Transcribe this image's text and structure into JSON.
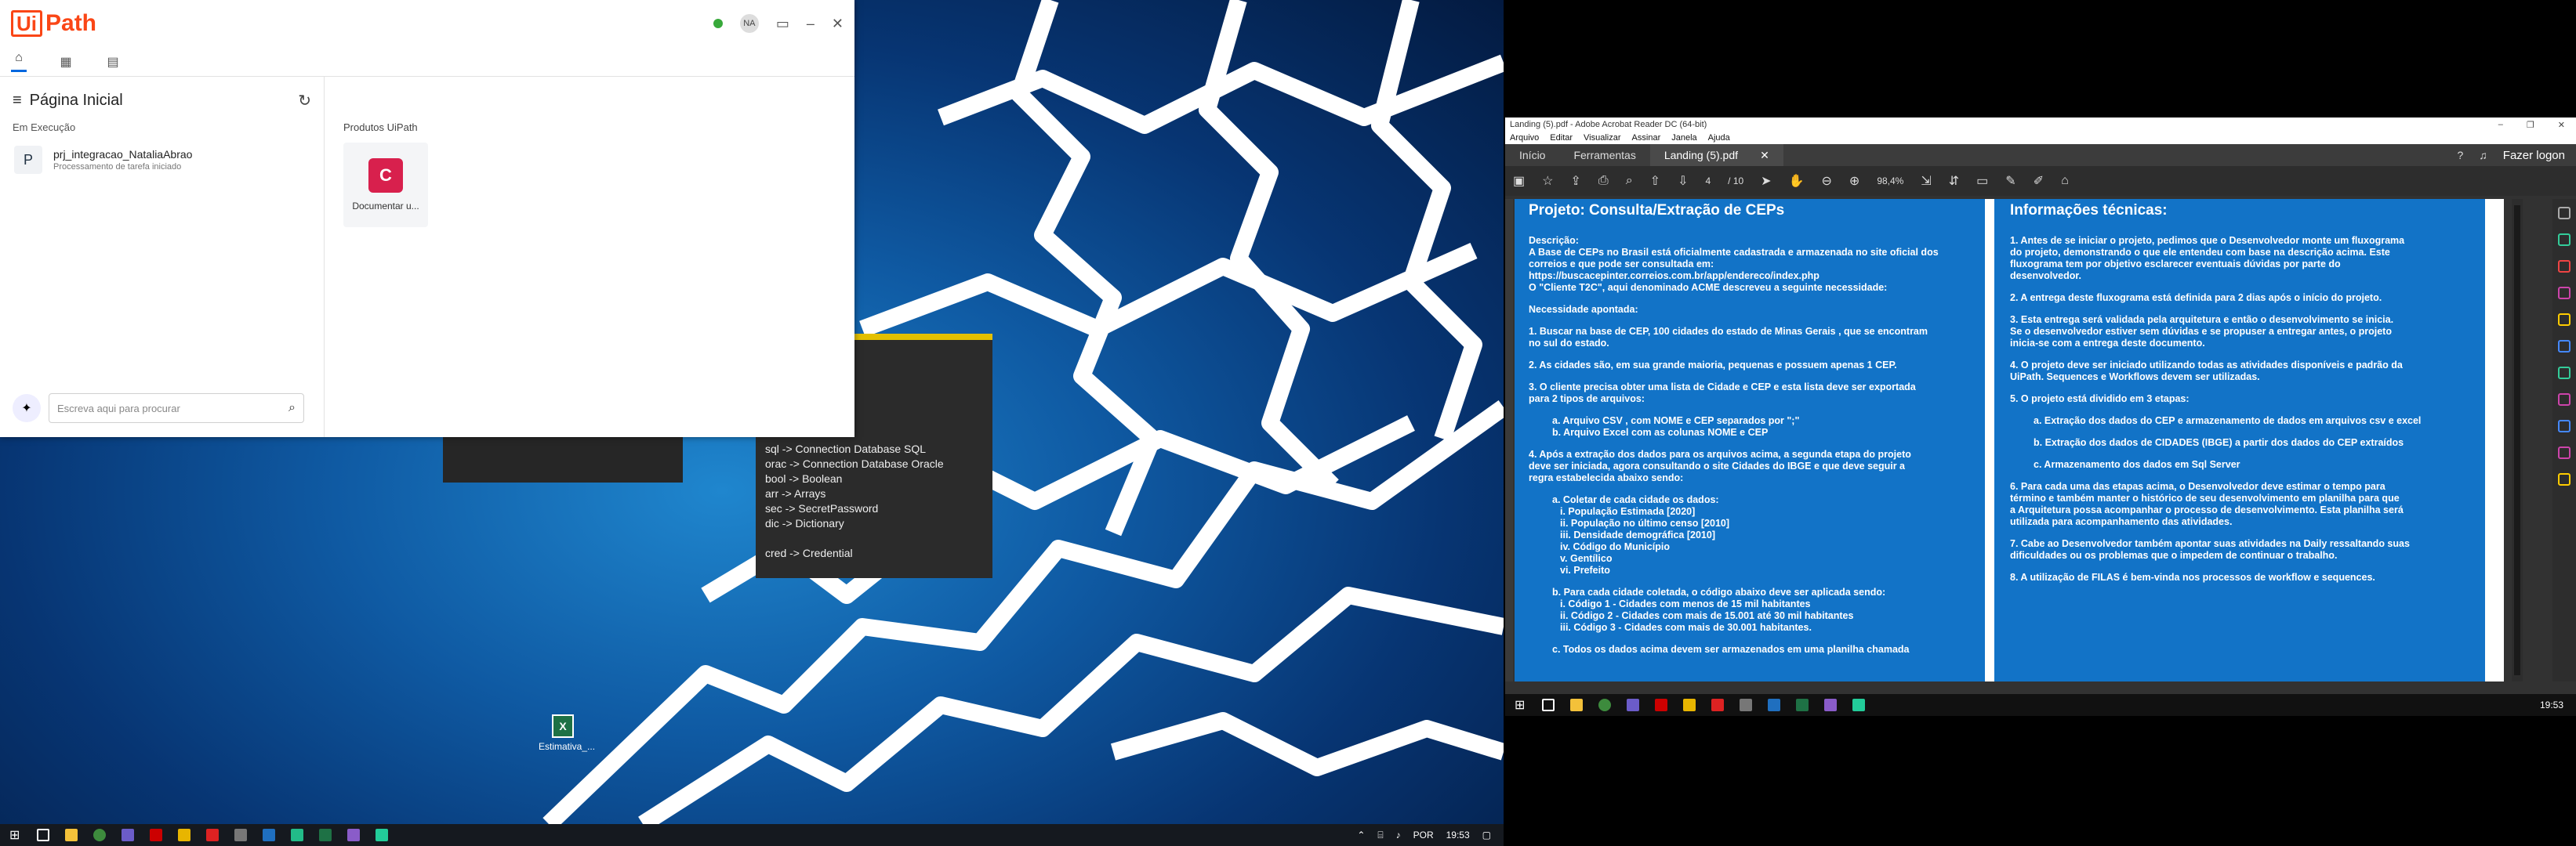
{
  "colors": {
    "uipath_orange": "#fa4616",
    "acrobat_blue": "#1273c7",
    "popup_accent": "#e3c000"
  },
  "uipath": {
    "logo_box": "Ui",
    "logo_text": "Path",
    "window_controls": [
      "minimize",
      "close"
    ],
    "avatar": "NA",
    "page_title": "Página Inicial",
    "section_running": "Em Execução",
    "process": {
      "icon": "P",
      "name": "prj_integracao_NataliaAbrao",
      "status": "Processamento de tarefa iniciado"
    },
    "products_title": "Produtos UiPath",
    "product_card_label": "Documentar u...",
    "search_placeholder": "Escreva aqui para procurar"
  },
  "popup": {
    "items": [
      "sql -> Connection Database SQL",
      "orac -> Connection Database Oracle",
      "bool -> Boolean",
      "arr -> Arrays",
      "sec -> SecretPassword",
      "dic -> Dictionary",
      "",
      "cred -> Credential"
    ]
  },
  "desktop_icon": {
    "label": "Estimativa_..."
  },
  "taskbar_left": {
    "lang": "POR",
    "time": "19:53"
  },
  "taskbar_right": {
    "time": "19:53"
  },
  "acrobat": {
    "title": "Landing (5).pdf - Adobe Acrobat Reader DC (64-bit)",
    "menu": [
      "Arquivo",
      "Editar",
      "Visualizar",
      "Assinar",
      "Janela",
      "Ajuda"
    ],
    "tabs": {
      "home": "Início",
      "tools": "Ferramentas",
      "doc": "Landing (5).pdf",
      "login": "Fazer logon"
    },
    "page_current": "4",
    "page_total": "/ 10",
    "zoom": "98,4%",
    "col1": {
      "title": "Projeto: Consulta/Extração de CEPs",
      "lines": [
        {
          "t": "Descrição:",
          "c": ""
        },
        {
          "t": "A Base de CEPs no Brasil está oficialmente cadastrada e armazenada no site oficial dos",
          "c": ""
        },
        {
          "t": "correios e que pode ser consultada em:",
          "c": ""
        },
        {
          "t": "https://buscacepinter.correios.com.br/app/endereco/index.php",
          "c": ""
        },
        {
          "t": "O \"Cliente T2C\", aqui denominado ACME descreveu a seguinte necessidade:",
          "c": ""
        },
        {
          "t": "",
          "c": "sp"
        },
        {
          "t": "Necessidade apontada:",
          "c": ""
        },
        {
          "t": "",
          "c": "sp"
        },
        {
          "t": "1. Buscar na base de CEP, 100 cidades do estado de Minas Gerais , que se encontram",
          "c": ""
        },
        {
          "t": "no sul do estado.",
          "c": ""
        },
        {
          "t": "",
          "c": "sp"
        },
        {
          "t": "2. As cidades são, em sua grande maioria, pequenas e possuem apenas 1 CEP.",
          "c": ""
        },
        {
          "t": "",
          "c": "sp"
        },
        {
          "t": "3. O cliente precisa obter uma lista de Cidade e CEP e esta lista deve ser exportada",
          "c": ""
        },
        {
          "t": "para 2 tipos de arquivos:",
          "c": ""
        },
        {
          "t": "",
          "c": "sp"
        },
        {
          "t": "a. Arquivo CSV , com NOME e CEP separados por \";\"",
          "c": "ind"
        },
        {
          "t": "b. Arquivo Excel com as colunas NOME e CEP",
          "c": "ind"
        },
        {
          "t": "",
          "c": "sp"
        },
        {
          "t": "4. Após a extração dos dados para os arquivos acima, a segunda etapa do projeto",
          "c": ""
        },
        {
          "t": "deve ser iniciada, agora consultando o site Cidades do IBGE e que deve seguir a",
          "c": ""
        },
        {
          "t": "regra estabelecida abaixo sendo:",
          "c": ""
        },
        {
          "t": "",
          "c": "sp"
        },
        {
          "t": "a. Coletar de cada cidade os dados:",
          "c": "ind"
        },
        {
          "t": "i. População Estimada [2020]",
          "c": "ind2"
        },
        {
          "t": "ii. População no último censo [2010]",
          "c": "ind2"
        },
        {
          "t": "iii. Densidade demográfica [2010]",
          "c": "ind2"
        },
        {
          "t": "iv. Código do Município",
          "c": "ind2"
        },
        {
          "t": "v. Gentílico",
          "c": "ind2"
        },
        {
          "t": "vi. Prefeito",
          "c": "ind2"
        },
        {
          "t": "",
          "c": "sp"
        },
        {
          "t": "b. Para cada cidade coletada, o código abaixo deve ser aplicada sendo:",
          "c": "ind"
        },
        {
          "t": "i. Código 1 - Cidades com menos de 15 mil habitantes",
          "c": "ind2"
        },
        {
          "t": "ii. Código 2 - Cidades com mais de 15.001 até 30 mil habitantes",
          "c": "ind2"
        },
        {
          "t": "iii. Código 3 - Cidades com mais de 30.001 habitantes.",
          "c": "ind2"
        },
        {
          "t": "",
          "c": "sp"
        },
        {
          "t": "c. Todos os dados acima devem ser armazenados em uma planilha chamada",
          "c": "ind"
        }
      ]
    },
    "col2": {
      "title": "Informações técnicas:",
      "lines": [
        {
          "t": "1. Antes de se iniciar o projeto, pedimos que o Desenvolvedor monte um fluxograma",
          "c": ""
        },
        {
          "t": "do projeto, demonstrando o que ele entendeu com base na descrição acima. Este",
          "c": ""
        },
        {
          "t": "fluxograma tem por objetivo esclarecer eventuais dúvidas por parte do",
          "c": ""
        },
        {
          "t": "desenvolvedor.",
          "c": ""
        },
        {
          "t": "",
          "c": "sp"
        },
        {
          "t": "2. A entrega deste fluxograma está definida para 2 dias após o início do projeto.",
          "c": ""
        },
        {
          "t": "",
          "c": "sp"
        },
        {
          "t": "3. Esta entrega será validada pela arquitetura e então o desenvolvimento se inicia.",
          "c": ""
        },
        {
          "t": "Se o desenvolvedor estiver sem dúvidas e se propuser a entregar antes, o projeto",
          "c": ""
        },
        {
          "t": "inicia-se com a entrega deste documento.",
          "c": ""
        },
        {
          "t": "",
          "c": "sp"
        },
        {
          "t": "4. O projeto deve ser iniciado utilizando todas as atividades disponíveis e padrão da",
          "c": ""
        },
        {
          "t": "UiPath. Sequences e Workflows devem ser utilizadas.",
          "c": ""
        },
        {
          "t": "",
          "c": "sp"
        },
        {
          "t": "5. O projeto está dividido em 3 etapas:",
          "c": ""
        },
        {
          "t": "",
          "c": "sp"
        },
        {
          "t": "a. Extração dos dados do CEP e armazenamento de dados em arquivos csv e excel",
          "c": "ind"
        },
        {
          "t": "",
          "c": "sp"
        },
        {
          "t": "b. Extração dos dados de CIDADES (IBGE) a partir dos dados do CEP extraídos",
          "c": "ind"
        },
        {
          "t": "",
          "c": "sp"
        },
        {
          "t": "c. Armazenamento dos dados em Sql Server",
          "c": "ind"
        },
        {
          "t": "",
          "c": "sp"
        },
        {
          "t": "6. Para cada uma das etapas acima, o Desenvolvedor deve estimar o tempo para",
          "c": ""
        },
        {
          "t": "término e também manter o histórico de seu desenvolvimento em planilha para que",
          "c": ""
        },
        {
          "t": "a Arquitetura possa acompanhar o processo de desenvolvimento. Esta planilha será",
          "c": ""
        },
        {
          "t": "utilizada para acompanhamento das atividades.",
          "c": ""
        },
        {
          "t": "",
          "c": "sp"
        },
        {
          "t": "7. Cabe ao Desenvolvedor também apontar suas atividades na Daily ressaltando suas",
          "c": ""
        },
        {
          "t": "dificuldades ou os problemas que o impedem de continuar o trabalho.",
          "c": ""
        },
        {
          "t": "",
          "c": "sp"
        },
        {
          "t": "8. A utilização de FILAS é bem-vinda nos processos de workflow e sequences.",
          "c": ""
        }
      ]
    }
  }
}
